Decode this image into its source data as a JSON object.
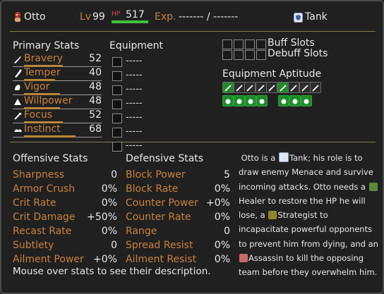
{
  "header": {
    "name": "Otto",
    "level_label": "Lv",
    "level": "99",
    "hp_label": "HP",
    "hp": "517",
    "hp_fraction": 1.0,
    "exp_label": "Exp.",
    "exp_value": "------- / -------",
    "role": "Tank"
  },
  "primary": {
    "title": "Primary Stats",
    "stats": [
      {
        "label": "Bravery",
        "value": "52",
        "icon": "bravery-icon",
        "fraction": 0.5
      },
      {
        "label": "Temper",
        "value": "40",
        "icon": "temper-icon",
        "fraction": 0.4
      },
      {
        "label": "Vigor",
        "value": "48",
        "icon": "vigor-icon",
        "fraction": 0.46
      },
      {
        "label": "Willpower",
        "value": "48",
        "icon": "willpower-icon",
        "fraction": 0.46
      },
      {
        "label": "Focus",
        "value": "52",
        "icon": "focus-icon",
        "fraction": 0.5
      },
      {
        "label": "Instinct",
        "value": "68",
        "icon": "instinct-icon",
        "fraction": 0.66
      }
    ]
  },
  "equipment": {
    "title": "Equipment",
    "slots": [
      "-----",
      "-----",
      "-----",
      "-----",
      "-----",
      "-----",
      "-----"
    ]
  },
  "slots": {
    "buff_label": "Buff Slots",
    "debuff_label": "Debuff Slots"
  },
  "aptitude": {
    "title": "Equipment Aptitude",
    "row1": [
      "sword-icon",
      "dagger-icon",
      "spear-icon",
      "staff-icon",
      "book-icon",
      "club-icon",
      "axe-icon",
      "bow-icon",
      "whip-icon"
    ],
    "row2": [
      "shield-icon",
      "wand-icon",
      "mace-icon",
      "orb-icon",
      "armor-icon",
      "robe-icon",
      "chainmail-icon"
    ]
  },
  "offensive": {
    "title": "Offensive Stats",
    "stats": [
      {
        "label": "Sharpness",
        "value": "0"
      },
      {
        "label": "Armor Crush",
        "value": "0%"
      },
      {
        "label": "Crit Rate",
        "value": "0%"
      },
      {
        "label": "Crit Damage",
        "value": "+50%"
      },
      {
        "label": "Recast Rate",
        "value": "0%"
      },
      {
        "label": "Subtlety",
        "value": "0"
      },
      {
        "label": "Ailment Power",
        "value": "+0%"
      }
    ]
  },
  "defensive": {
    "title": "Defensive Stats",
    "stats": [
      {
        "label": "Block Power",
        "value": "5"
      },
      {
        "label": "Block Rate",
        "value": "0%"
      },
      {
        "label": "Counter Power",
        "value": "+0%"
      },
      {
        "label": "Counter Rate",
        "value": "0%"
      },
      {
        "label": "Range",
        "value": "0"
      },
      {
        "label": "Spread Resist",
        "value": "0%"
      },
      {
        "label": "Ailment Resist",
        "value": "0%"
      }
    ]
  },
  "description": {
    "p1": "Otto is a",
    "role1": "Tank",
    "p2": "; his role is to draw enemy Menace and survive incoming attacks. Otto needs a",
    "role2": "Healer",
    "p3": "to restore the HP he will lose, a",
    "role3": "Strategist",
    "p4": "to incapacitate powerful opponents to prevent him from dying, and an",
    "role4": "Assassin",
    "p5": "to kill the opposing team before they overwhelm him."
  },
  "footer": "Mouse over stats to see their description.",
  "colors": {
    "orange": "#c8813e",
    "hp_green": "#3cc43c",
    "hp_label": "#e04a4a",
    "separator": "#8a7a52",
    "aptitude_green": "#1f8a2a"
  }
}
